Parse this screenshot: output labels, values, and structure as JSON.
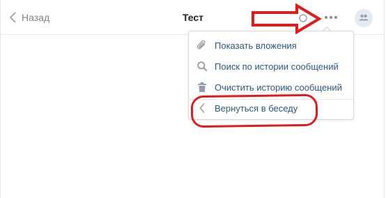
{
  "header": {
    "back_label": "Назад",
    "title": "Тест"
  },
  "icons": {
    "back": "chevron-left-icon",
    "more": "more-dots-icon",
    "status": "circle-icon",
    "avatar": "group-avatar-icon"
  },
  "menu": {
    "items": [
      {
        "label": "Показать вложения",
        "icon": "paperclip-icon"
      },
      {
        "label": "Поиск по истории сообщений",
        "icon": "search-icon"
      },
      {
        "label": "Очистить историю сообщений",
        "icon": "trash-icon"
      },
      {
        "label": "Вернуться в беседу",
        "icon": "chevron-left-icon"
      }
    ]
  },
  "colors": {
    "link": "#2a5885",
    "muted": "#828282",
    "icon": "#939cb0",
    "annotation": "#e11a1a"
  }
}
